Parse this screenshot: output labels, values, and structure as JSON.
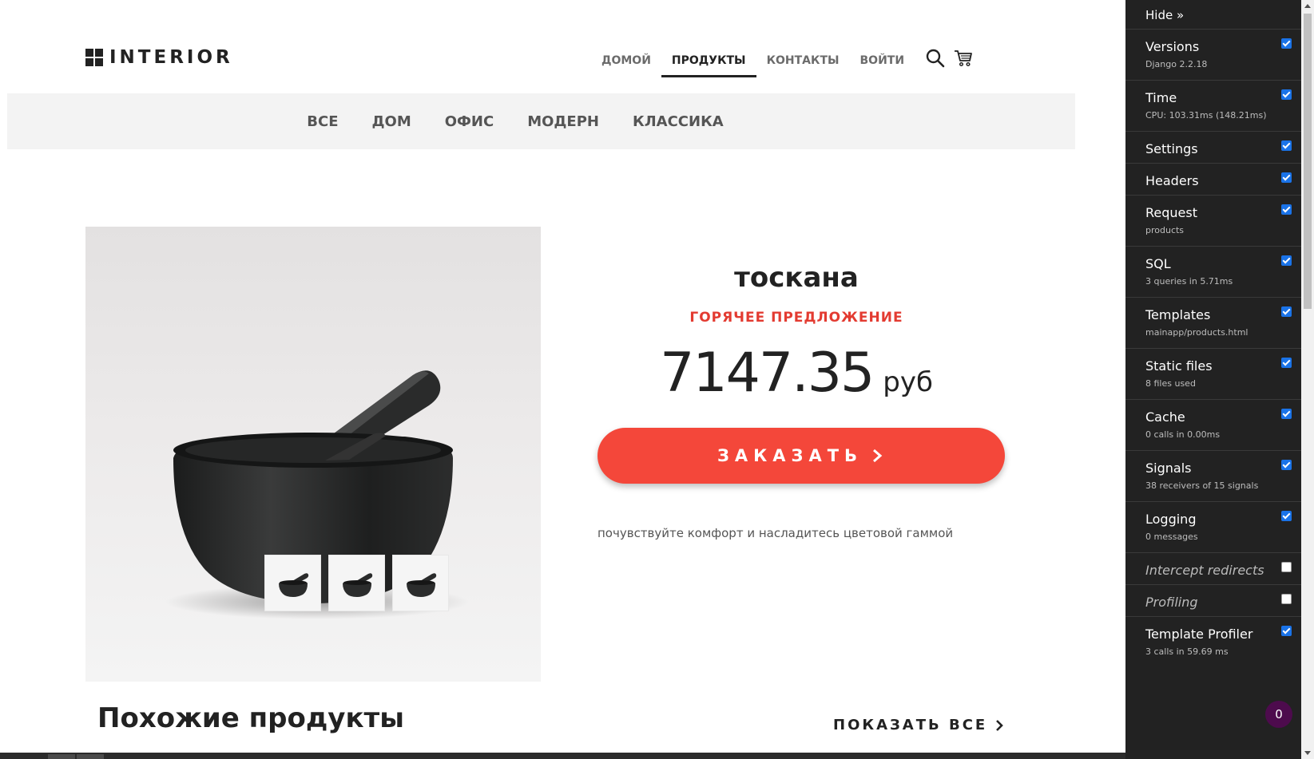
{
  "brand": {
    "logo_text": "INTERIOR"
  },
  "main_nav": [
    {
      "label": "ДОМОЙ",
      "active": false
    },
    {
      "label": "ПРОДУКТЫ",
      "active": true
    },
    {
      "label": "КОНТАКТЫ",
      "active": false
    },
    {
      "label": "ВОЙТИ",
      "active": false
    }
  ],
  "header_icons": [
    "search-icon",
    "cart-icon"
  ],
  "categories": [
    "ВСЕ",
    "ДОМ",
    "ОФИС",
    "МОДЕРН",
    "КЛАССИКА"
  ],
  "product": {
    "title": "тоскана",
    "hot_label": "ГОРЯЧЕЕ ПРЕДЛОЖЕНИЕ",
    "price": "7147.35",
    "currency": "руб",
    "order_label": "ЗАКАЗАТЬ",
    "description": "почувствуйте комфорт и насладитесь цветовой гаммой",
    "thumbnail_count": 3
  },
  "similar": {
    "title": "Похожие продукты",
    "show_all_label": "ПОКАЗАТЬ ВСЕ"
  },
  "debug_toolbar": {
    "hide_label": "Hide »",
    "panels": [
      {
        "name": "Versions",
        "sub": "Django 2.2.18",
        "checked": true,
        "italic": false
      },
      {
        "name": "Time",
        "sub": "CPU: 103.31ms (148.21ms)",
        "checked": true,
        "italic": false
      },
      {
        "name": "Settings",
        "sub": "",
        "checked": true,
        "italic": false
      },
      {
        "name": "Headers",
        "sub": "",
        "checked": true,
        "italic": false
      },
      {
        "name": "Request",
        "sub": "products",
        "checked": true,
        "italic": false
      },
      {
        "name": "SQL",
        "sub": "3 queries in 5.71ms",
        "checked": true,
        "italic": false
      },
      {
        "name": "Templates",
        "sub": "mainapp/products.html",
        "checked": true,
        "italic": false
      },
      {
        "name": "Static files",
        "sub": "8 files used",
        "checked": true,
        "italic": false
      },
      {
        "name": "Cache",
        "sub": "0 calls in 0.00ms",
        "checked": true,
        "italic": false
      },
      {
        "name": "Signals",
        "sub": "38 receivers of 15 signals",
        "checked": true,
        "italic": false
      },
      {
        "name": "Logging",
        "sub": "0 messages",
        "checked": true,
        "italic": false
      },
      {
        "name": "Intercept redirects",
        "sub": "",
        "checked": false,
        "italic": true
      },
      {
        "name": "Profiling",
        "sub": "",
        "checked": false,
        "italic": true
      },
      {
        "name": "Template Profiler",
        "sub": "3 calls in 59.69 ms",
        "checked": true,
        "italic": false
      }
    ],
    "badge": "0"
  },
  "colors": {
    "accent": "#f4473a",
    "hot": "#e33b31",
    "toolbar_bg": "#222222",
    "checkbox": "#1a73e8",
    "badge": "#4d0b4d"
  }
}
